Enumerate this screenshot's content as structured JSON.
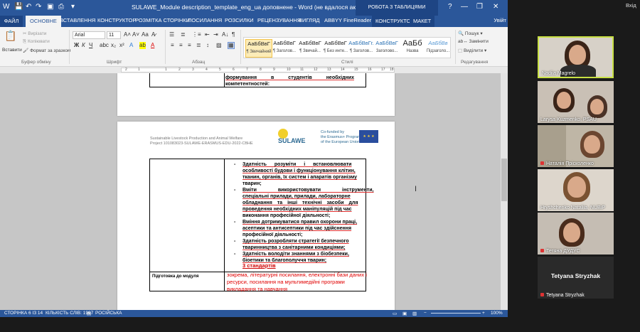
{
  "window": {
    "title": "SULAWE_Module description_template_eng_ua доповнене - Word (не вдалося активувати продукт)",
    "context_title": "РОБОТА З ТАБЛИЦЯМИ",
    "quick_access": [
      "save-icon",
      "undo-icon",
      "redo-icon",
      "open-icon",
      "print-icon"
    ],
    "controls": [
      "?",
      "—",
      "❐",
      "✕"
    ]
  },
  "tabs": {
    "file": "ФАЙЛ",
    "home": "ОСНОВНЕ",
    "insert": "ВСТАВЛЕННЯ",
    "design": "КОНСТРУКТОР",
    "layout": "РОЗМІТКА СТОРІНКИ",
    "references": "ПОСИЛАННЯ",
    "mailings": "РОЗСИЛКИ",
    "review": "РЕЦЕНЗУВАННЯ",
    "view": "ВИГЛЯД",
    "abbyy": "ABBYY FineReader 12",
    "table_design": "КОНСТРУКТОР",
    "table_layout": "МАКЕТ",
    "user": "Увійт"
  },
  "ribbon": {
    "clipboard": {
      "paste": "Вставити",
      "cut": "Вирізати",
      "copy": "Копіювати",
      "format_painter": "Формат за зразком",
      "label": "Буфер обміну"
    },
    "font": {
      "name": "Arial",
      "size": "11",
      "label": "Шрифт",
      "bold": "Ж",
      "italic": "К",
      "underline": "Ч"
    },
    "paragraph": {
      "label": "Абзац"
    },
    "styles": {
      "label": "Стилі",
      "items": [
        {
          "sample": "АаБбВвГ",
          "name": "¶ Звичайний"
        },
        {
          "sample": "АаБбВвГ",
          "name": "¶ Заголов..."
        },
        {
          "sample": "АаБбВвГ",
          "name": "¶ Звичай..."
        },
        {
          "sample": "АаБбВвГ",
          "name": "¶ Без инте..."
        },
        {
          "sample": "АаБбВвГг.",
          "name": "¶ Заголов..."
        },
        {
          "sample": "АаБбВвГ",
          "name": "Заголово..."
        },
        {
          "sample": "АаБб",
          "name": "Назва"
        },
        {
          "sample": "АаБбВв",
          "name": "Підзаголо..."
        }
      ]
    },
    "editing": {
      "find": "Пошук",
      "replace": "Замінити",
      "select": "Виділити",
      "label": "Редагування"
    }
  },
  "ruler": {
    "ticks": [
      "2",
      "1",
      "1",
      "2",
      "3",
      "4",
      "5",
      "6",
      "7",
      "8",
      "9",
      "10",
      "11",
      "12",
      "13",
      "14",
      "15",
      "16",
      "17",
      "18"
    ]
  },
  "document": {
    "page1_lines": [
      "формування в студентів необхідних",
      "компетентностей:"
    ],
    "header": {
      "left_line1": "Sustainable Livestock Production and Animal Welfare",
      "left_line2": "Project 101083023-SULAWE-ERASMUS-EDU-2022-CBHE",
      "logo": "SULAWE",
      "cofund_line1": "Co-funded by",
      "cofund_line2": "the Erasmus+ Programme",
      "cofund_line3": "of the European Union"
    },
    "bullets": [
      "Здатність розуміти і встановлювати",
      "особливості будови і функціонування клітин,",
      "тканин, органів, їх систем і апаратів організму",
      "тварин;",
      "Вміти використовувати інструменти,",
      "спеціальні прилади, прилади, лабораторне",
      "обладнання та інші технічні засоби для",
      "проведення необхідних маніпуляцій під час",
      "виконання професійної діяльності;",
      "Вміння дотримуватися правил охорони праці,",
      "асептики та антисептики під час здійснення",
      "професійної діяльності;",
      "Здатність розробляти стратегії безпечного",
      "тваринництва з санітарними кондиціями;",
      "Здатність володіти знаннями з біобезпеки,",
      "біоетики та благополуччя тварин;"
    ],
    "standards": "3 стандартів",
    "row2_label": "Підготовка до модуля",
    "row2_lines": [
      "зокрема, літературні посилання, електронні бази даних і",
      "ресурси, посилання на мультимедійні програми",
      "викладання та навчання"
    ]
  },
  "status": {
    "page": "СТОРІНКА 6 ІЗ 14",
    "words": "КІЛЬКІСТЬ СЛІВ: 1997",
    "language": "РОСІЙСЬКА",
    "zoom": "100%"
  },
  "video": {
    "exit": "Вхід",
    "participants": [
      "Nadiia Magrelo",
      "Larysa Kuzmenko, PSAU",
      "Наталія Прісколенко",
      "Hryshchenko Nataliia, NUBiP",
      "Тетяна ДУДУС",
      "Tetyana Stryzhak"
    ],
    "big_name": "Tetyana Stryzhak"
  },
  "colors": {
    "word_blue": "#2b579a",
    "highlight_border": "#c8e044",
    "red_text": "#e00000"
  }
}
